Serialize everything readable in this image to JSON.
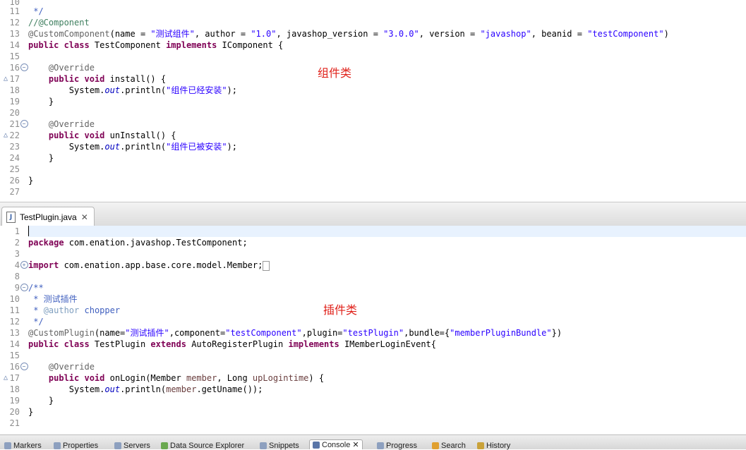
{
  "top_editor": {
    "lines": [
      {
        "n": "10",
        "text": ""
      },
      {
        "n": "11",
        "text": " */"
      },
      {
        "n": "12",
        "text": "//@Component"
      },
      {
        "n": "13",
        "text": "@CustomComponent(name = \"测试组件\", author = \"1.0\", javashop_version = \"3.0.0\", version = \"javashop\", beanid = \"testComponent\")"
      },
      {
        "n": "14",
        "text": "public class TestComponent implements IComponent {"
      },
      {
        "n": "15",
        "text": ""
      },
      {
        "n": "16",
        "text": "    @Override"
      },
      {
        "n": "17",
        "text": "    public void install() {"
      },
      {
        "n": "18",
        "text": "        System.out.println(\"组件已经安装\");"
      },
      {
        "n": "19",
        "text": "    }"
      },
      {
        "n": "20",
        "text": ""
      },
      {
        "n": "21",
        "text": "    @Override"
      },
      {
        "n": "22",
        "text": "    public void unInstall() {"
      },
      {
        "n": "23",
        "text": "        System.out.println(\"组件已被安装\");"
      },
      {
        "n": "24",
        "text": "    }"
      },
      {
        "n": "25",
        "text": ""
      },
      {
        "n": "26",
        "text": "}"
      },
      {
        "n": "27",
        "text": ""
      }
    ],
    "annotation_note": "组件类"
  },
  "tab": {
    "label": "TestPlugin.java",
    "icon": "java-file-icon"
  },
  "bottom_editor": {
    "lines": [
      {
        "n": "1",
        "text": ""
      },
      {
        "n": "2",
        "text": "package com.enation.javashop.TestComponent;"
      },
      {
        "n": "3",
        "text": ""
      },
      {
        "n": "4",
        "text": "import com.enation.app.base.core.model.Member;"
      },
      {
        "n": "8",
        "text": ""
      },
      {
        "n": "9",
        "text": "/**"
      },
      {
        "n": "10",
        "text": " * 测试插件"
      },
      {
        "n": "11",
        "text": " * @author chopper"
      },
      {
        "n": "12",
        "text": " */"
      },
      {
        "n": "13",
        "text": "@CustomPlugin(name=\"测试插件\",component=\"testComponent\",plugin=\"testPlugin\",bundle={\"memberPluginBundle\"})"
      },
      {
        "n": "14",
        "text": "public class TestPlugin extends AutoRegisterPlugin implements IMemberLoginEvent{"
      },
      {
        "n": "15",
        "text": ""
      },
      {
        "n": "16",
        "text": "    @Override"
      },
      {
        "n": "17",
        "text": "    public void onLogin(Member member, Long upLogintime) {"
      },
      {
        "n": "18",
        "text": "        System.out.println(member.getUname());"
      },
      {
        "n": "19",
        "text": "    }"
      },
      {
        "n": "20",
        "text": "}"
      },
      {
        "n": "21",
        "text": ""
      }
    ],
    "annotation_note": "插件类"
  },
  "bottom_tabs": [
    "Markers",
    "Properties",
    "Servers",
    "Data Source Explorer",
    "Snippets",
    "Console",
    "Progress",
    "Search",
    "History"
  ]
}
